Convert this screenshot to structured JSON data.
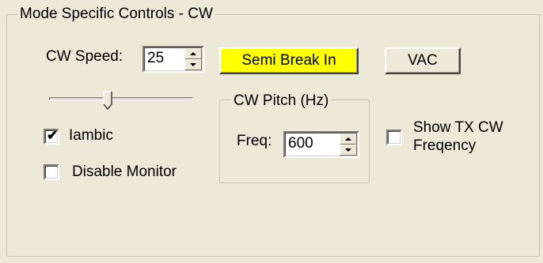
{
  "outer_group": {
    "title": "Mode Specific Controls - CW"
  },
  "cw_speed": {
    "label": "CW Speed:",
    "value": "25"
  },
  "semi_break_in": {
    "label": "Semi Break In",
    "color": "#ffff00"
  },
  "vac": {
    "label": "VAC"
  },
  "speed_slider": {
    "level": 0.4
  },
  "iambic": {
    "label": "Iambic",
    "checked": true
  },
  "disable_monitor": {
    "label": "Disable Monitor",
    "checked": false
  },
  "pitch_group": {
    "title": "CW Pitch (Hz)",
    "freq_label": "Freq:",
    "freq_value": "600"
  },
  "show_tx": {
    "label_line1": "Show TX CW",
    "label_line2": "Freqency",
    "checked": false
  },
  "icons": {
    "check": "✔",
    "spin_up": "triangle-up",
    "spin_down": "triangle-down"
  }
}
